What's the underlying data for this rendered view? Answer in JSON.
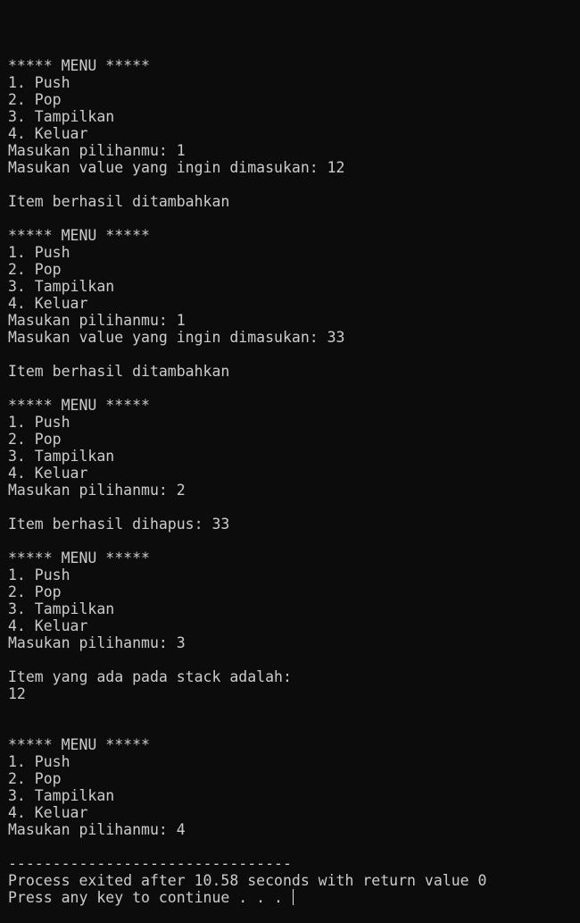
{
  "console": {
    "lines": [
      "***** MENU *****",
      "1. Push",
      "2. Pop",
      "3. Tampilkan",
      "4. Keluar",
      "Masukan pilihanmu: 1",
      "Masukan value yang ingin dimasukan: 12",
      "",
      "Item berhasil ditambahkan",
      "",
      "***** MENU *****",
      "1. Push",
      "2. Pop",
      "3. Tampilkan",
      "4. Keluar",
      "Masukan pilihanmu: 1",
      "Masukan value yang ingin dimasukan: 33",
      "",
      "Item berhasil ditambahkan",
      "",
      "***** MENU *****",
      "1. Push",
      "2. Pop",
      "3. Tampilkan",
      "4. Keluar",
      "Masukan pilihanmu: 2",
      "",
      "Item berhasil dihapus: 33",
      "",
      "***** MENU *****",
      "1. Push",
      "2. Pop",
      "3. Tampilkan",
      "4. Keluar",
      "Masukan pilihanmu: 3",
      "",
      "Item yang ada pada stack adalah:",
      "12",
      "",
      "",
      "***** MENU *****",
      "1. Push",
      "2. Pop",
      "3. Tampilkan",
      "4. Keluar",
      "Masukan pilihanmu: 4",
      "",
      "--------------------------------",
      "Process exited after 10.58 seconds with return value 0",
      "Press any key to continue . . . "
    ]
  },
  "colors": {
    "background": "#0c0c0c",
    "text": "#cccccc"
  }
}
